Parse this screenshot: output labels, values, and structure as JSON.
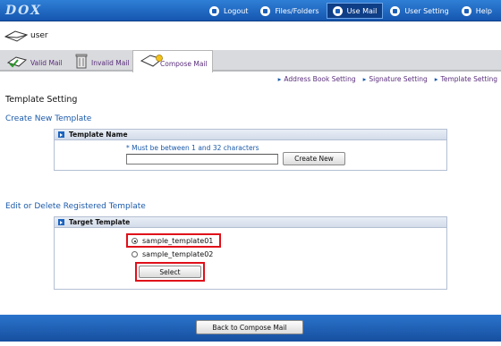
{
  "app": {
    "logo": "DOX"
  },
  "nav": [
    {
      "label": "Logout",
      "icon": "logout-icon",
      "active": false
    },
    {
      "label": "Files/Folders",
      "icon": "files-icon",
      "active": false
    },
    {
      "label": "Use Mail",
      "icon": "mail-icon",
      "active": true
    },
    {
      "label": "User Setting",
      "icon": "user-setting-icon",
      "active": false
    },
    {
      "label": "Help",
      "icon": "help-icon",
      "active": false
    }
  ],
  "user": {
    "name": "user"
  },
  "tabs": [
    {
      "label": "Valid Mail",
      "active": false
    },
    {
      "label": "Invalid Mail",
      "active": false
    },
    {
      "label": "Compose Mail",
      "active": true
    }
  ],
  "sublinks": [
    "Address Book Setting",
    "Signature Setting",
    "Template Setting"
  ],
  "page_title": "Template Setting",
  "create": {
    "section_title": "Create New Template",
    "panel_title": "Template Name",
    "note": "* Must be between 1 and 32 characters",
    "input_value": "",
    "button": "Create New"
  },
  "edit": {
    "section_title": "Edit or Delete Registered Template",
    "panel_title": "Target Template",
    "options": [
      {
        "label": "sample_template01",
        "checked": true
      },
      {
        "label": "sample_template02",
        "checked": false
      }
    ],
    "button": "Select"
  },
  "footer": {
    "back_button": "Back to Compose Mail"
  },
  "colors": {
    "accent": "#1b5aaa",
    "highlight": "#e0101a",
    "bar": "#1f63bd"
  }
}
